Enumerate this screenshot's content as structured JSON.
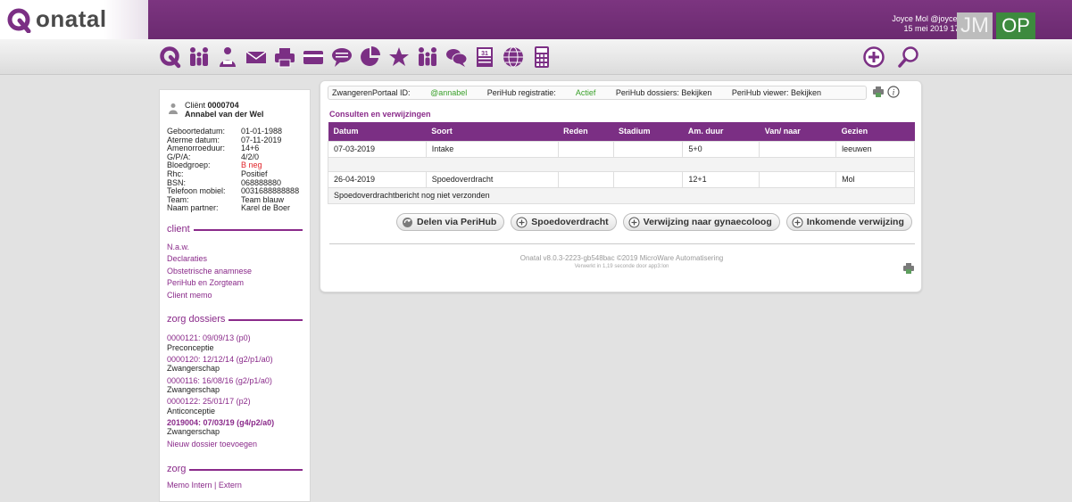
{
  "app": {
    "logo_text": "onatal"
  },
  "user": {
    "name_line": "Joyce Mol @joycemol",
    "datetime": "15 mei 2019 17:26",
    "avatar_initials": "JM",
    "secondary_initials": "OP"
  },
  "colors": {
    "brand_purple": "#7b2f84",
    "link_purple": "#8a2a8a",
    "green": "#3aa02a",
    "red": "#e0242a"
  },
  "toolbar": {
    "icons": [
      "onatal-logo-icon",
      "family-icon",
      "person-icon",
      "mail-icon",
      "print-icon",
      "card-icon",
      "chat-bubble-icon",
      "pie-chart-icon",
      "star-icon",
      "family-icon",
      "chat-icon",
      "calendar-icon",
      "globe-icon",
      "calculator-icon",
      "add-icon",
      "search-icon"
    ],
    "calendar_day": "31"
  },
  "sidebar": {
    "client_label": "Cliënt",
    "client_number": "0000704",
    "client_name": "Annabel van der Wel",
    "info": [
      {
        "label": "Geboortedatum:",
        "value": "01-01-1988"
      },
      {
        "label": "Aterme datum:",
        "value": "07-11-2019"
      },
      {
        "label": "Amenorroeduur:",
        "value": "14+6"
      },
      {
        "label": "G/P/A:",
        "value": "4/2/0"
      },
      {
        "label": "Bloedgroep:",
        "value": "B neg"
      },
      {
        "label": "Rhc:",
        "value": "Positief"
      },
      {
        "label": "BSN:",
        "value": "068888880"
      },
      {
        "label": "Telefoon mobiel:",
        "value": "0031688888888"
      },
      {
        "label": "Team:",
        "value": "Team blauw"
      },
      {
        "label": "Naam partner:",
        "value": "Karel de Boer"
      }
    ],
    "section_client": "client",
    "client_links": [
      "N.a.w.",
      "Declaraties",
      "Obstetrische anamnese",
      "PeriHub en Zorgteam",
      "Client memo"
    ],
    "section_dossiers": "zorg dossiers",
    "dossiers": [
      {
        "link": "0000121: 09/09/13 (p0)",
        "type": "Preconceptie"
      },
      {
        "link": "0000120: 12/12/14 (g2/p1/a0)",
        "type": "Zwangerschap"
      },
      {
        "link": "0000116: 16/08/16 (g2/p1/a0)",
        "type": "Zwangerschap"
      },
      {
        "link": "0000122: 25/01/17 (p2)",
        "type": "Anticonceptie"
      },
      {
        "link": "2019004: 07/03/19 (g4/p2/a0)",
        "type": "Zwangerschap"
      }
    ],
    "new_dossier": "Nieuw dossier toevoegen",
    "section_zorg": "zorg",
    "zorg_partial": "Memo Intern | Extern"
  },
  "portal": {
    "portal_label": "ZwangerenPortaal ID:",
    "portal_id": "@annabel",
    "perihub_reg_label": "PeriHub registratie:",
    "perihub_reg_value": "Actief",
    "perihub_dossiers": "PeriHub dossiers: Bekijken",
    "perihub_viewer": "PeriHub viewer: Bekijken"
  },
  "consults": {
    "title": "Consulten en verwijzingen",
    "columns": [
      "Datum",
      "Soort",
      "Reden",
      "Stadium",
      "Am. duur",
      "Van/ naar",
      "Gezien"
    ],
    "rows": [
      [
        "07-03-2019",
        "Intake",
        "",
        "",
        "5+0",
        "",
        "leeuwen"
      ],
      [
        "26-04-2019",
        "Spoedoverdracht",
        "",
        "",
        "12+1",
        "",
        "Mol"
      ]
    ],
    "note": "Spoedoverdrachtbericht nog niet verzonden"
  },
  "buttons": {
    "share": "Delen via PeriHub",
    "spoed": "Spoedoverdracht",
    "verwijzing": "Verwijzing naar gynaecoloog",
    "inkomend": "Inkomende verwijzing"
  },
  "footer": {
    "version": "Onatal v8.0.3-2223-gb548bac ©2019 MicroWare Automatisering",
    "processed": "Verwerkt in 1,19 seconde door app3:lon"
  }
}
